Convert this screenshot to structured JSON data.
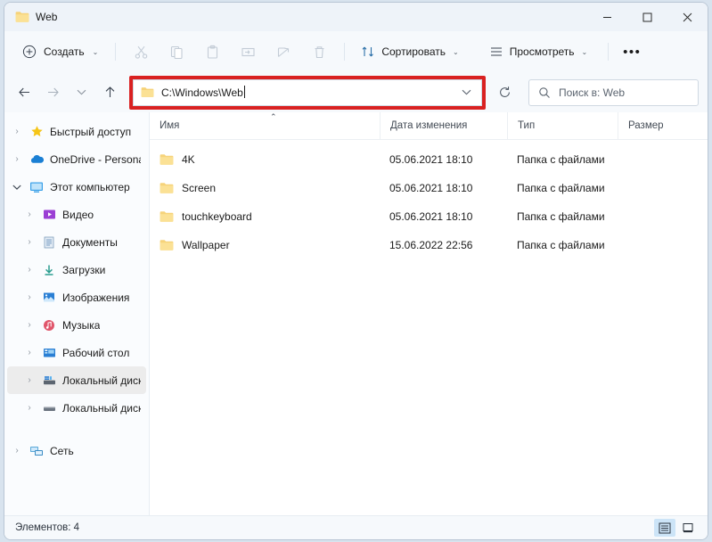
{
  "window": {
    "tab_title": "Web",
    "minimize_label": "–",
    "maximize_label": "☐",
    "close_label": "✕"
  },
  "toolbar": {
    "new_label": "Создать",
    "sort_label": "Сортировать",
    "view_label": "Просмотреть",
    "more_label": "•••",
    "icons": [
      "cut-icon",
      "copy-icon",
      "paste-icon",
      "rename-icon",
      "share-icon",
      "delete-icon"
    ],
    "chevron": "⌄"
  },
  "address": {
    "back_label": "←",
    "forward_label": "→",
    "recent_label": "⌄",
    "up_label": "↑",
    "path": "C:\\Windows\\Web",
    "dropdown_label": "⌄",
    "highlight_color": "#d92121"
  },
  "search": {
    "placeholder": "Поиск в: Web"
  },
  "sidebar": {
    "items": [
      {
        "label": "Быстрый доступ",
        "icon": "star-icon",
        "level": 1,
        "expanded": false
      },
      {
        "label": "OneDrive - Personal",
        "icon": "cloud-icon",
        "level": 1,
        "expanded": false
      },
      {
        "label": "Этот компьютер",
        "icon": "computer-icon",
        "level": 1,
        "expanded": true
      },
      {
        "label": "Видео",
        "icon": "video-icon",
        "level": 2,
        "expanded": false
      },
      {
        "label": "Документы",
        "icon": "documents-icon",
        "level": 2,
        "expanded": false
      },
      {
        "label": "Загрузки",
        "icon": "downloads-icon",
        "level": 2,
        "expanded": false
      },
      {
        "label": "Изображения",
        "icon": "pictures-icon",
        "level": 2,
        "expanded": false
      },
      {
        "label": "Музыка",
        "icon": "music-icon",
        "level": 2,
        "expanded": false
      },
      {
        "label": "Рабочий стол",
        "icon": "desktop-icon",
        "level": 2,
        "expanded": false
      },
      {
        "label": "Локальный диск (",
        "icon": "system-drive-icon",
        "level": 2,
        "expanded": false,
        "hovered": true
      },
      {
        "label": "Локальный диск (",
        "icon": "drive-icon",
        "level": 2,
        "expanded": false
      },
      {
        "label": "Сеть",
        "icon": "network-icon",
        "level": 1,
        "expanded": false
      }
    ],
    "collapsed_chevron": "›",
    "expanded_chevron": "⌄"
  },
  "filelist": {
    "columns": [
      {
        "key": "name",
        "label": "Имя"
      },
      {
        "key": "date",
        "label": "Дата изменения"
      },
      {
        "key": "type",
        "label": "Тип"
      },
      {
        "key": "size",
        "label": "Размер"
      }
    ],
    "sort_indicator": "⌃",
    "rows": [
      {
        "name": "4K",
        "date": "05.06.2021 18:10",
        "type": "Папка с файлами",
        "size": ""
      },
      {
        "name": "Screen",
        "date": "05.06.2021 18:10",
        "type": "Папка с файлами",
        "size": ""
      },
      {
        "name": "touchkeyboard",
        "date": "05.06.2021 18:10",
        "type": "Папка с файлами",
        "size": ""
      },
      {
        "name": "Wallpaper",
        "date": "15.06.2022 22:56",
        "type": "Папка с файлами",
        "size": ""
      }
    ]
  },
  "status": {
    "items_text": "Элементов: 4",
    "view_details": "details-view-icon",
    "view_large": "large-icons-view-icon"
  }
}
